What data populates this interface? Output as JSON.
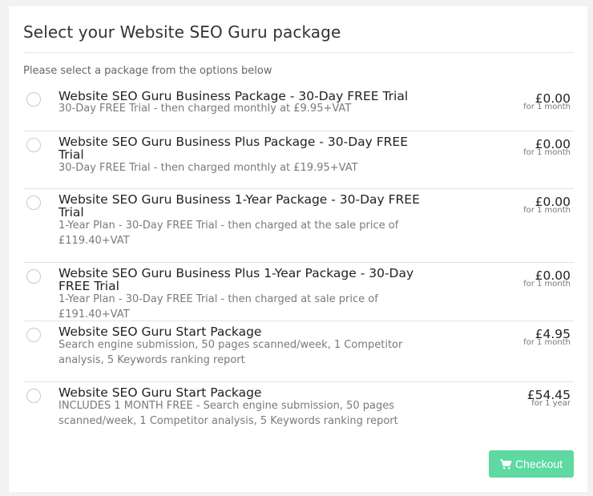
{
  "page": {
    "title": "Select your Website SEO Guru package",
    "subtitle": "Please select a package from the options below"
  },
  "packages": [
    {
      "name": "Website SEO Guru Business Package - 30-Day FREE Trial",
      "description": "30-Day FREE Trial - then charged monthly at £9.95+VAT",
      "price": "£0.00",
      "period": "for 1 month",
      "selected": false
    },
    {
      "name": "Website SEO Guru Business Plus Package - 30-Day FREE Trial",
      "description": "30-Day FREE Trial - then charged monthly at £19.95+VAT",
      "price": "£0.00",
      "period": "for 1 month",
      "selected": false
    },
    {
      "name": "Website SEO Guru Business 1-Year Package - 30-Day FREE Trial",
      "description": "1-Year Plan - 30-Day FREE Trial - then charged at the sale price of £119.40+VAT",
      "price": "£0.00",
      "period": "for 1 month",
      "selected": false
    },
    {
      "name": "Website SEO Guru Business Plus 1-Year Package - 30-Day FREE Trial",
      "description": "1-Year Plan - 30-Day FREE Trial - then charged at sale price of £191.40+VAT",
      "price": "£0.00",
      "period": "for 1 month",
      "selected": false
    },
    {
      "name": "Website SEO Guru Start Package",
      "description": "Search engine submission, 50 pages scanned/week, 1 Competitor analysis, 5 Keywords ranking report",
      "price": "£4.95",
      "period": "for 1 month",
      "selected": false
    },
    {
      "name": "Website SEO Guru Start Package",
      "description": "INCLUDES 1 MONTH FREE - Search engine submission, 50 pages scanned/week, 1 Competitor analysis, 5 Keywords ranking report",
      "price": "£54.45",
      "period": "for 1 year",
      "selected": false
    }
  ],
  "checkout": {
    "label": "Checkout",
    "icon": "shopping-cart-icon",
    "color": "#5ed9a1"
  }
}
